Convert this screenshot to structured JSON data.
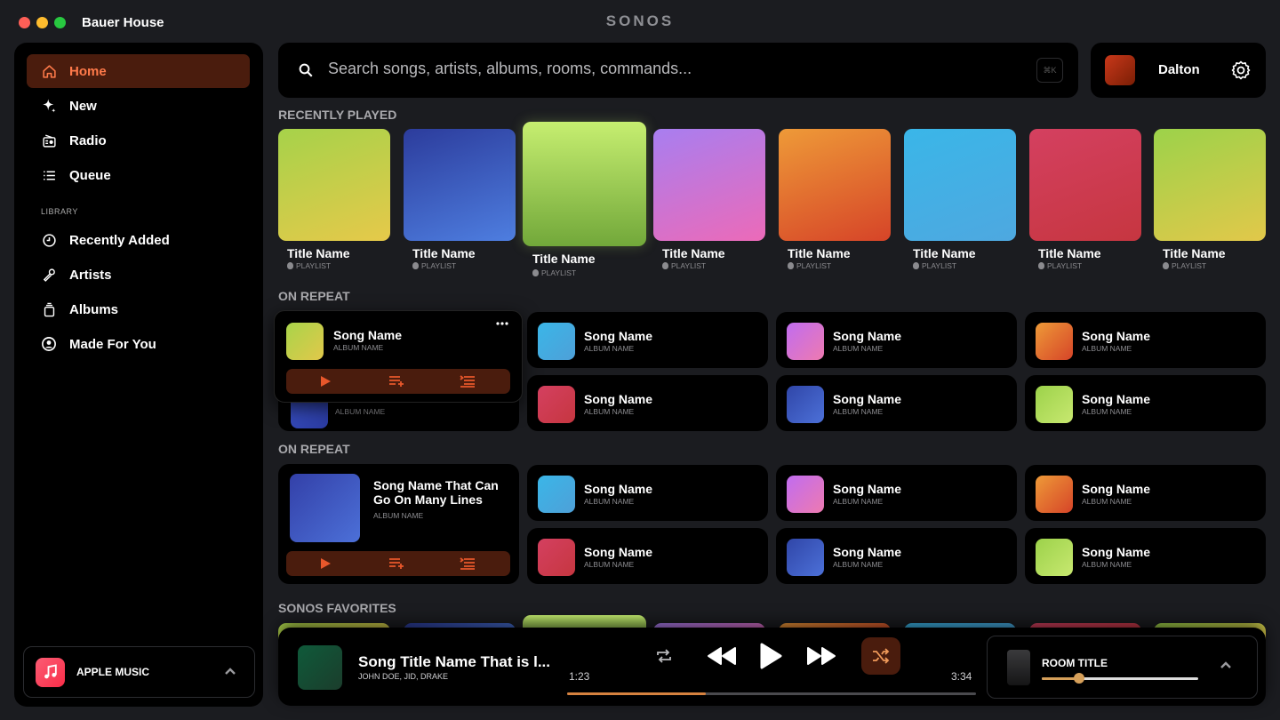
{
  "window": {
    "title": "Bauer House",
    "brand": "SONOS"
  },
  "colors": {
    "accent": "#ff7a4a",
    "accent_bg": "#4a1c0d",
    "close": "#ff5f57",
    "minimize": "#febc2e",
    "zoom": "#28c840"
  },
  "sidebar": {
    "items": [
      {
        "label": "Home",
        "icon": "home-icon",
        "active": true
      },
      {
        "label": "New",
        "icon": "sparkle-icon"
      },
      {
        "label": "Radio",
        "icon": "radio-icon"
      },
      {
        "label": "Queue",
        "icon": "list-icon"
      }
    ],
    "library_heading": "LIBRARY",
    "library": [
      {
        "label": "Recently Added",
        "icon": "clock-icon"
      },
      {
        "label": "Artists",
        "icon": "microphone-icon"
      },
      {
        "label": "Albums",
        "icon": "albums-icon"
      },
      {
        "label": "Made For You",
        "icon": "user-circle-icon"
      }
    ],
    "service": {
      "label": "APPLE MUSIC",
      "icon": "apple-music-icon"
    }
  },
  "search": {
    "placeholder": "Search songs, artists, albums, rooms, commands...",
    "shortcut": "⌘K"
  },
  "user": {
    "name": "Dalton"
  },
  "recently_played": {
    "heading": "RECENTLY PLAYED",
    "tiles": [
      {
        "title": "Title Name",
        "sub": "PLAYLIST"
      },
      {
        "title": "Title Name",
        "sub": "PLAYLIST"
      },
      {
        "title": "Title Name",
        "sub": "PLAYLIST"
      },
      {
        "title": "Title Name",
        "sub": "PLAYLIST"
      },
      {
        "title": "Title Name",
        "sub": "PLAYLIST"
      },
      {
        "title": "Title Name",
        "sub": "PLAYLIST"
      },
      {
        "title": "Title Name",
        "sub": "PLAYLIST"
      },
      {
        "title": "Title Name",
        "sub": "PLAYLIST"
      }
    ]
  },
  "on_repeat_1": {
    "heading": "ON REPEAT",
    "expanded": {
      "name": "Song Name",
      "album": "ALBUM NAME"
    },
    "hidden_album": "ALBUM NAME",
    "songs": [
      {
        "name": "Song Name",
        "album": "ALBUM NAME"
      },
      {
        "name": "Song Name",
        "album": "ALBUM NAME"
      },
      {
        "name": "Song Name",
        "album": "ALBUM NAME"
      },
      {
        "name": "Song Name",
        "album": "ALBUM NAME"
      },
      {
        "name": "Song Name",
        "album": "ALBUM NAME"
      },
      {
        "name": "Song Name",
        "album": "ALBUM NAME"
      }
    ]
  },
  "on_repeat_2": {
    "heading": "ON REPEAT",
    "featured": {
      "name": "Song Name That Can Go On Many Lines",
      "album": "ALBUM NAME"
    },
    "songs": [
      {
        "name": "Song Name",
        "album": "ALBUM NAME"
      },
      {
        "name": "Song Name",
        "album": "ALBUM NAME"
      },
      {
        "name": "Song Name",
        "album": "ALBUM NAME"
      },
      {
        "name": "Song Name",
        "album": "ALBUM NAME"
      },
      {
        "name": "Song Name",
        "album": "ALBUM NAME"
      },
      {
        "name": "Song Name",
        "album": "ALBUM NAME"
      }
    ]
  },
  "favorites": {
    "heading": "SONOS FAVORITES"
  },
  "player": {
    "title": "Song Title Name That is l...",
    "artists": "JOHN DOE, JID, DRAKE",
    "elapsed": "1:23",
    "duration": "3:34",
    "progress": 0.34,
    "room": "ROOM TITLE",
    "volume": 0.24
  }
}
